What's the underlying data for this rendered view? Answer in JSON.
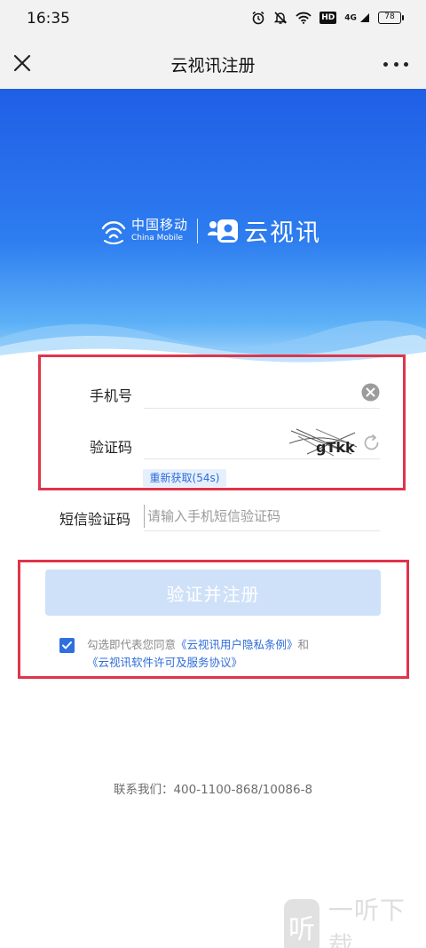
{
  "status_bar": {
    "time": "16:35",
    "icons": [
      "alarm-icon",
      "mute-icon",
      "wifi-icon",
      "hd-icon",
      "signal-4g-icon",
      "battery-icon"
    ],
    "hd_label": "HD",
    "signal_label": "4G",
    "battery_level": "78"
  },
  "nav": {
    "title": "云视讯注册",
    "close_icon": "close-icon",
    "more_icon": "more-icon"
  },
  "banner": {
    "brand_cn": "中国移动",
    "brand_en": "China Mobile",
    "product_name": "云视讯",
    "colors": {
      "top": "#1f5fe6",
      "bottom": "#a9d8fb"
    }
  },
  "form": {
    "phone_label": "手机号",
    "phone_value": "",
    "captcha_label": "验证码",
    "captcha_image_text": "gTkk",
    "resend_label": "重新获取(54s)",
    "sms_label": "短信验证码",
    "sms_placeholder": "请输入手机短信验证码",
    "submit_label": "验证并注册"
  },
  "agreement": {
    "checked": true,
    "prefix": "勾选即代表您同意",
    "privacy_link": "《云视讯用户隐私条例》",
    "connector": "和",
    "license_link": "《云视讯软件许可及服务协议》"
  },
  "footer": {
    "contact": "联系我们：400-1100-868/10086-8"
  },
  "watermark": {
    "badge": "听",
    "text": "一听下载"
  },
  "colors": {
    "accent": "#2f6cd8",
    "button_disabled": "#cfe0f9",
    "highlight_frame": "#e0344b"
  }
}
